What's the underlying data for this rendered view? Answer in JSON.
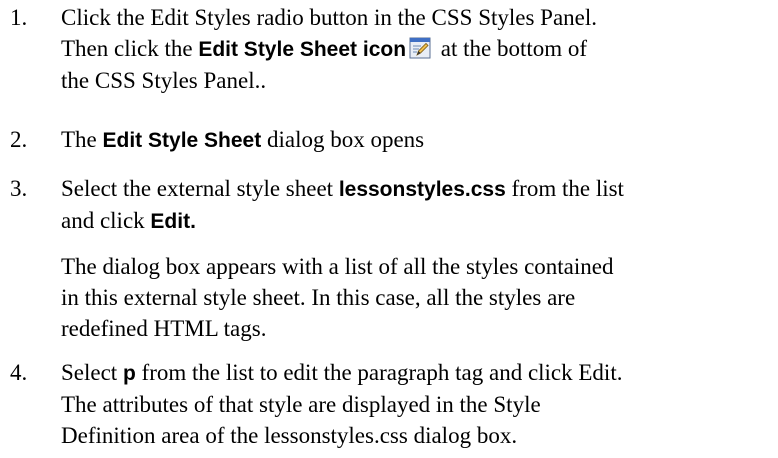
{
  "steps": [
    {
      "number": "1.",
      "line1": "Click the Edit Styles radio button in the CSS Styles Panel.",
      "line2_pre": "Then click the ",
      "line2_bold": "Edit Style Sheet icon",
      "line2_post": " at the bottom of",
      "line3": "the CSS Styles Panel..",
      "icon": "edit-style-sheet-icon"
    },
    {
      "number": "2.",
      "pre": "The ",
      "bold": "Edit Style Sheet",
      "post": " dialog box opens"
    },
    {
      "number": "3.",
      "line1_pre": "Select the external style sheet ",
      "line1_bold": "lessonstyles.css",
      "line1_post": " from the list",
      "line2_pre": "and click ",
      "line2_bold": "Edit.",
      "para2_line1": "The dialog box appears with a list of all the styles contained",
      "para2_line2": "in this external style sheet. In this case, all the styles are",
      "para2_line3": "redefined HTML tags."
    },
    {
      "number": "4.",
      "line1_pre": "Select ",
      "line1_bold": "p",
      "line1_post": " from the list to edit the paragraph tag and click Edit.",
      "line2": "The attributes of that style are displayed in the Style",
      "line3": "Definition area of the lessonstyles.css dialog box."
    }
  ]
}
